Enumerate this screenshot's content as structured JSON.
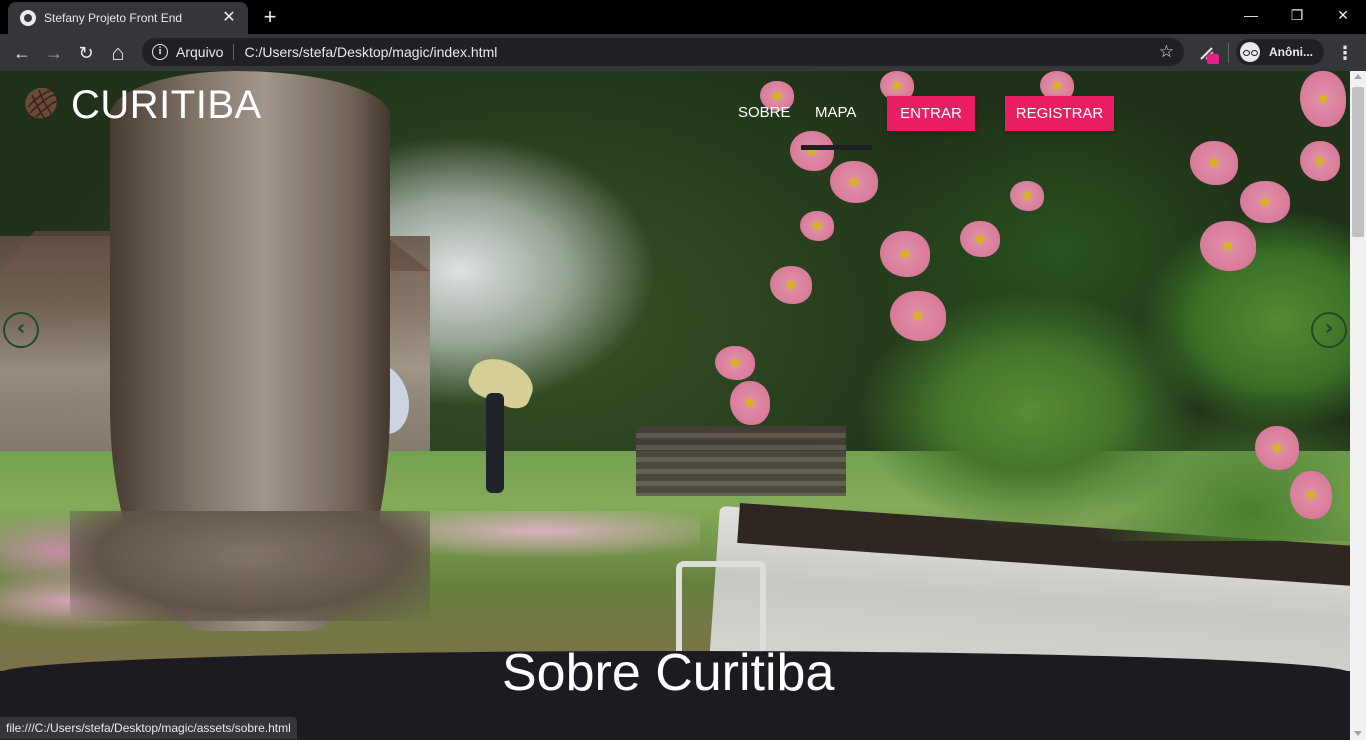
{
  "browser": {
    "tab_title": "Stefany Projeto Front End",
    "tab_close": "✕",
    "new_tab": "+",
    "window_controls": {
      "minimize": "—",
      "restore": "❐",
      "close": "✕"
    },
    "nav": {
      "back": "←",
      "forward": "→",
      "reload": "↻",
      "home": "⌂"
    },
    "origin_label": "Arquivo",
    "url": "C:/Users/stefa/Desktop/magic/index.html",
    "bookmark_icon": "☆",
    "profile_label": "Anôni...",
    "menu_icon": "⋮",
    "status_url": "file:///C:/Users/stefa/Desktop/magic/assets/sobre.html"
  },
  "site": {
    "logo_text": "CURITIBA",
    "nav": {
      "sobre": "SOBRE",
      "mapa": "MAPA",
      "entrar": "ENTRAR",
      "registrar": "REGISTRAR"
    },
    "carousel": {
      "prev": "‹",
      "next": "›"
    },
    "section_title": "Sobre Curitiba"
  },
  "colors": {
    "accent": "#e91e63",
    "chrome_dark": "#35363a",
    "page_dark": "#1c1b22",
    "carousel_arrow": "#234a28"
  }
}
